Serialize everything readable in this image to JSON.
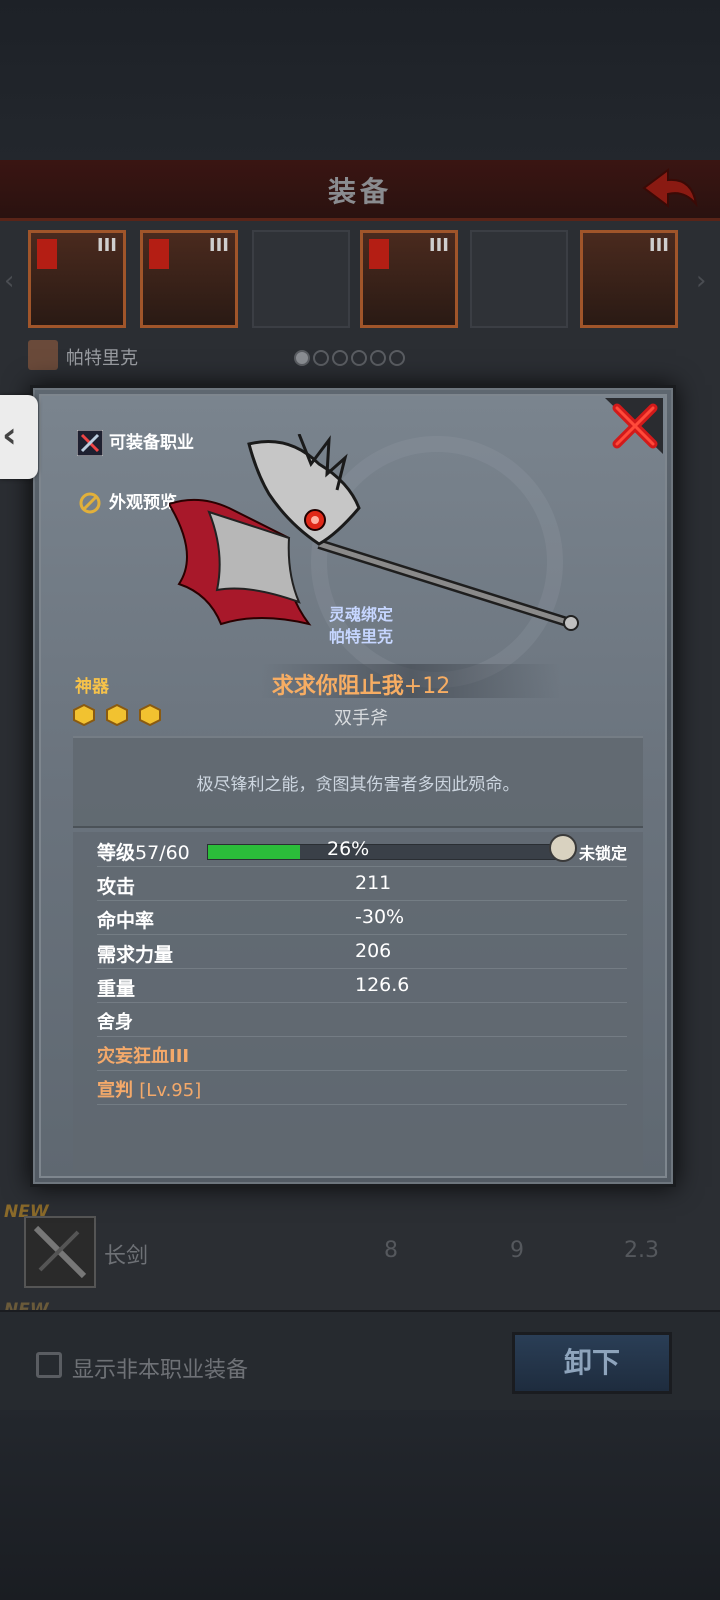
{
  "screen": {
    "title": "装备",
    "character_name": "帕特里克",
    "slots": [
      {
        "tier": "III",
        "state": "equipped"
      },
      {
        "tier": "III",
        "state": "equipped"
      },
      {
        "tier": "",
        "state": "empty"
      },
      {
        "tier": "III",
        "state": "equipped"
      },
      {
        "tier": "",
        "state": "empty"
      },
      {
        "tier": "III",
        "state": "equipped"
      }
    ],
    "page_dots_total": 6,
    "page_dots_active": 1
  },
  "list": {
    "new_tag": "NEW",
    "item_name": "长剑",
    "values": [
      "8",
      "9",
      "2.3"
    ],
    "new_tag_2": "NEW"
  },
  "bottom": {
    "checkbox_label": "显示非本职业装备",
    "unequip_label": "卸下"
  },
  "modal": {
    "equippable_classes_label": "可装备职业",
    "appearance_preview_label": "外观预览",
    "soul_bound_line1": "灵魂绑定",
    "soul_bound_line2": "帕特里克",
    "rarity": "神器",
    "item_name": "求求你阻止我",
    "enhance": "+12",
    "weapon_type": "双手斧",
    "gem_count": 3,
    "description": "极尽锋利之能，贪图其伤害者多因此殒命。",
    "level": {
      "label": "等级",
      "value": "57/60",
      "progress_percent": 26,
      "progress_text": "26%",
      "lock_status": "未锁定"
    },
    "stats": [
      {
        "label": "攻击",
        "value": "211"
      },
      {
        "label": "命中率",
        "value": "-30%"
      },
      {
        "label": "需求力量",
        "value": "206"
      },
      {
        "label": "重量",
        "value": "126.6"
      }
    ],
    "skills": [
      {
        "name": "舍身",
        "level": "",
        "color": "#ffffff"
      },
      {
        "name": "灾妄狂血III",
        "level": "",
        "color": "#f4a96a"
      },
      {
        "name": "宣判 ",
        "level": "[Lv.95]",
        "color": "#f4a96a"
      }
    ]
  },
  "colors": {
    "rarity": "#f6c24a",
    "item_name": "#f7ad63",
    "xp_fill": "#2bbd3a",
    "close_x": "#d21a1a"
  }
}
